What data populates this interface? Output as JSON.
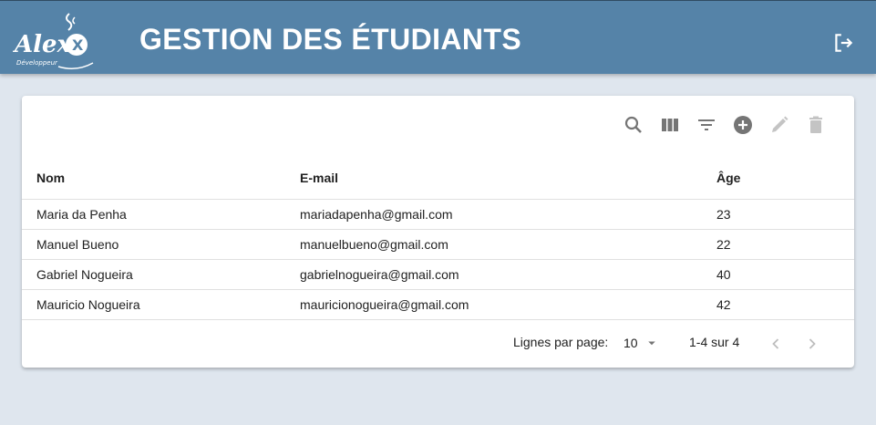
{
  "header": {
    "logo_text": "Alex",
    "logo_subtitle": "Développeur",
    "title": "GESTION DES ÉTUDIANTS",
    "logout_icon": "logout-icon",
    "bar_color": "#5583a8"
  },
  "toolbar": {
    "icons": [
      "search-icon",
      "columns-icon",
      "filter-icon",
      "add-circle-icon",
      "edit-icon",
      "delete-icon"
    ]
  },
  "table": {
    "columns": [
      "Nom",
      "E-mail",
      "Âge"
    ],
    "rows": [
      [
        "Maria da Penha",
        "mariadapenha@gmail.com",
        "23"
      ],
      [
        "Manuel Bueno",
        "manuelbueno@gmail.com",
        "22"
      ],
      [
        "Gabriel Nogueira",
        "gabrielnogueira@gmail.com",
        "40"
      ],
      [
        "Mauricio Nogueira",
        "mauricionogueira@gmail.com",
        "42"
      ]
    ]
  },
  "pagination": {
    "rows_per_page_label": "Lignes par page:",
    "rows_per_page_value": "10",
    "range_text": "1-4 sur 4"
  }
}
